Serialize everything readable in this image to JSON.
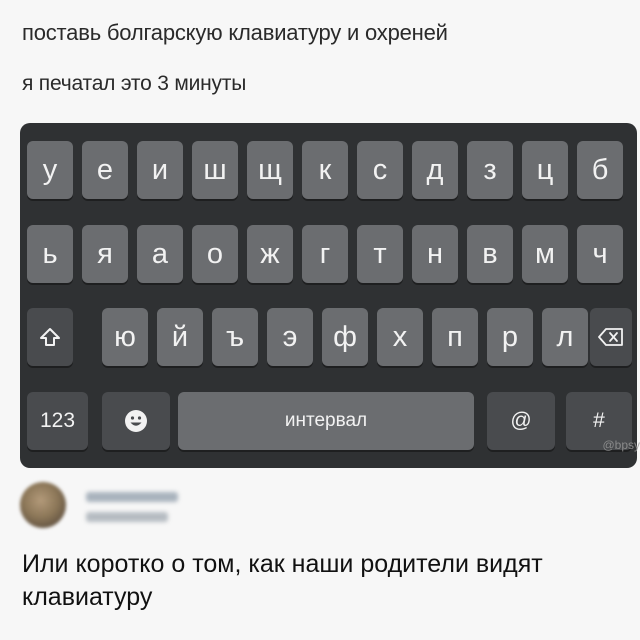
{
  "post": {
    "line1": "поставь болгарскую клавиатуру и  охреней",
    "line2": "я печатал это 3 минуты"
  },
  "keyboard": {
    "row1": [
      "у",
      "е",
      "и",
      "ш",
      "щ",
      "к",
      "с",
      "д",
      "з",
      "ц",
      "б"
    ],
    "row2": [
      "ь",
      "я",
      "а",
      "о",
      "ж",
      "г",
      "т",
      "н",
      "в",
      "м",
      "ч"
    ],
    "row3": [
      "ю",
      "й",
      "ъ",
      "э",
      "ф",
      "х",
      "п",
      "р",
      "л"
    ],
    "shift_icon": "shift-arrow-icon",
    "backspace_icon": "backspace-icon",
    "numbers_label": "123",
    "emoji_icon": "smiley-face-icon",
    "space_label": "интервал",
    "at_label": "@",
    "hash_label": "#"
  },
  "watermark": "@bpsy",
  "comment": {
    "caption": "Или коротко о том, как наши родители видят клавиатуру"
  }
}
